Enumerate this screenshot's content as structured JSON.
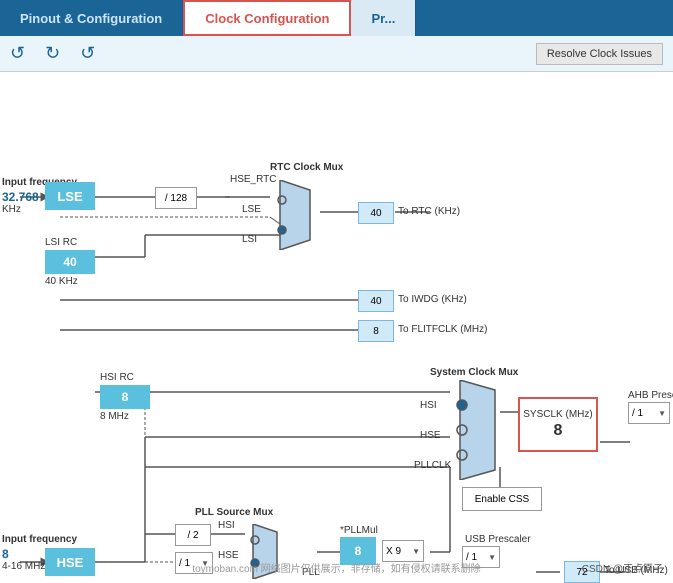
{
  "header": {
    "tabs": [
      {
        "label": "Pinout & Configuration",
        "state": "inactive"
      },
      {
        "label": "Clock Configuration",
        "state": "active"
      },
      {
        "label": "Pr...",
        "state": "inactive"
      }
    ]
  },
  "toolbar": {
    "undo_label": "↺",
    "redo_label": "↻",
    "refresh_label": "↺",
    "resolve_btn": "Resolve Clock Issues"
  },
  "canvas": {
    "lse_label": "LSE",
    "lsi_rc_label": "LSI RC",
    "hsi_rc_label": "HSI RC",
    "hse_label": "HSE",
    "input_freq_top_label": "Input frequency",
    "input_freq_top_value": "32.768",
    "input_freq_top_unit": "KHz",
    "input_freq_bot_label": "Input frequency",
    "input_freq_bot_value": "8",
    "input_freq_bot_unit": "4-16 MHz",
    "lsi_rc_freq": "40",
    "lsi_rc_freq_label": "40 KHz",
    "hsi_rc_freq": "8",
    "hsi_rc_freq_label": "8 MHz",
    "rtc_clock_mux": "RTC Clock Mux",
    "system_clock_mux": "System Clock Mux",
    "pll_source_mux": "PLL Source Mux",
    "hse_rtc": "HSE_RTC",
    "lse_line": "LSE",
    "lsi_line": "LSI",
    "hsi_line": "HSI",
    "hse_line": "HSE",
    "pllclk_line": "PLLCLK",
    "div128": "/ 128",
    "div1_pll": "/ 1",
    "div2": "/ 2",
    "x9": "X 9",
    "div1_usb": "/ 1",
    "div1_ahb": "/ 1",
    "pllmul_label": "*PLLMul",
    "pll_label": "PLL",
    "to_rtc": "To RTC (KHz)",
    "to_rtc_val": "40",
    "to_iwdg": "To IWDG (KHz)",
    "to_iwdg_val": "40",
    "to_flit": "To FLITFCLK (MHz)",
    "to_flit_val": "8",
    "to_usb": "To USB (MHz)",
    "to_usb_val": "72",
    "sysclk_label": "SYSCLK (MHz)",
    "sysclk_val": "8",
    "ahb_label": "AHB Prescaler",
    "ahb_val": "/ 1",
    "enable_css": "Enable CSS",
    "usb_prescaler": "USB Prescaler",
    "pll_val": "8"
  },
  "watermark": "toymoban.com 网络图片仅供展示，非存储，如有侵权请联系删除",
  "brand": "CSDN @正点原子"
}
